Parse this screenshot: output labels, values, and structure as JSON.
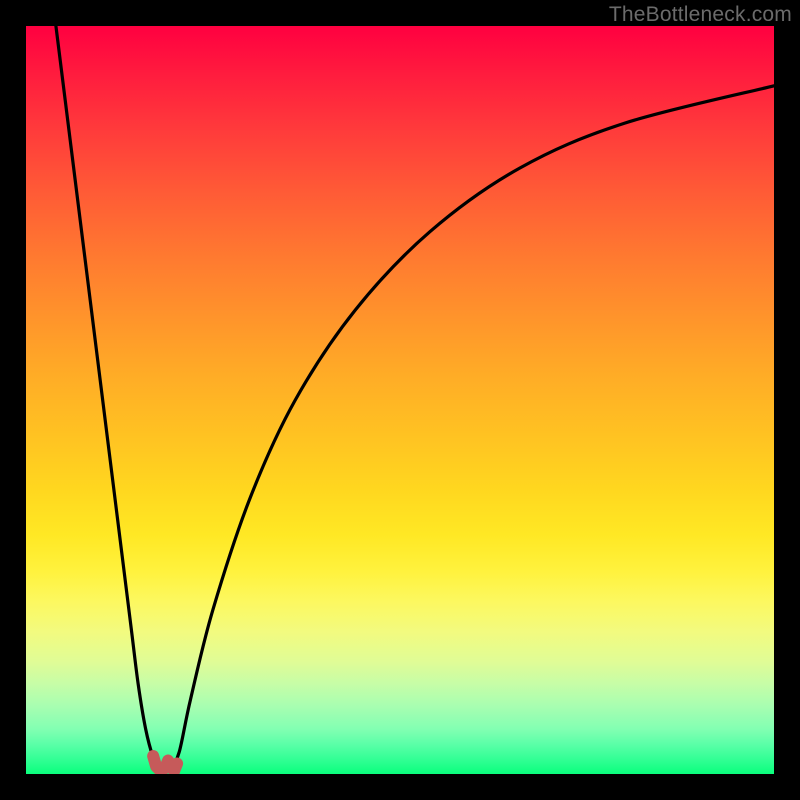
{
  "watermark": "TheBottleneck.com",
  "colors": {
    "frame": "#000000",
    "curve": "#000000",
    "marker": "#c65a5a",
    "gradient_top": "#ff0040",
    "gradient_bottom": "#0aff7d"
  },
  "chart_data": {
    "type": "line",
    "title": "",
    "xlabel": "",
    "ylabel": "",
    "xlim": [
      0,
      100
    ],
    "ylim": [
      0,
      100
    ],
    "grid": false,
    "legend": false,
    "annotations": [],
    "series": [
      {
        "name": "left-branch",
        "x": [
          4.0,
          6.0,
          8.0,
          10.0,
          12.0,
          14.0,
          15.0,
          16.0,
          17.0,
          17.8
        ],
        "y": [
          100,
          84,
          68,
          52,
          36,
          20,
          12,
          6,
          2.2,
          0.6
        ]
      },
      {
        "name": "right-branch",
        "x": [
          19.4,
          20.5,
          22,
          25,
          30,
          36,
          44,
          54,
          66,
          80,
          100
        ],
        "y": [
          0.6,
          3,
          10,
          22,
          37,
          50,
          62,
          72.5,
          81,
          87,
          92
        ]
      },
      {
        "name": "dip-marker",
        "x": [
          17.0,
          17.4,
          18.0,
          18.6,
          19.0,
          19.4,
          19.8,
          20.2
        ],
        "y": [
          2.4,
          1.0,
          0.4,
          0.8,
          1.8,
          1.0,
          0.4,
          1.4
        ]
      }
    ],
    "marker": {
      "x": 18.6,
      "y": 0.9,
      "width_pct": 3.2,
      "height_pct": 3.4
    }
  }
}
